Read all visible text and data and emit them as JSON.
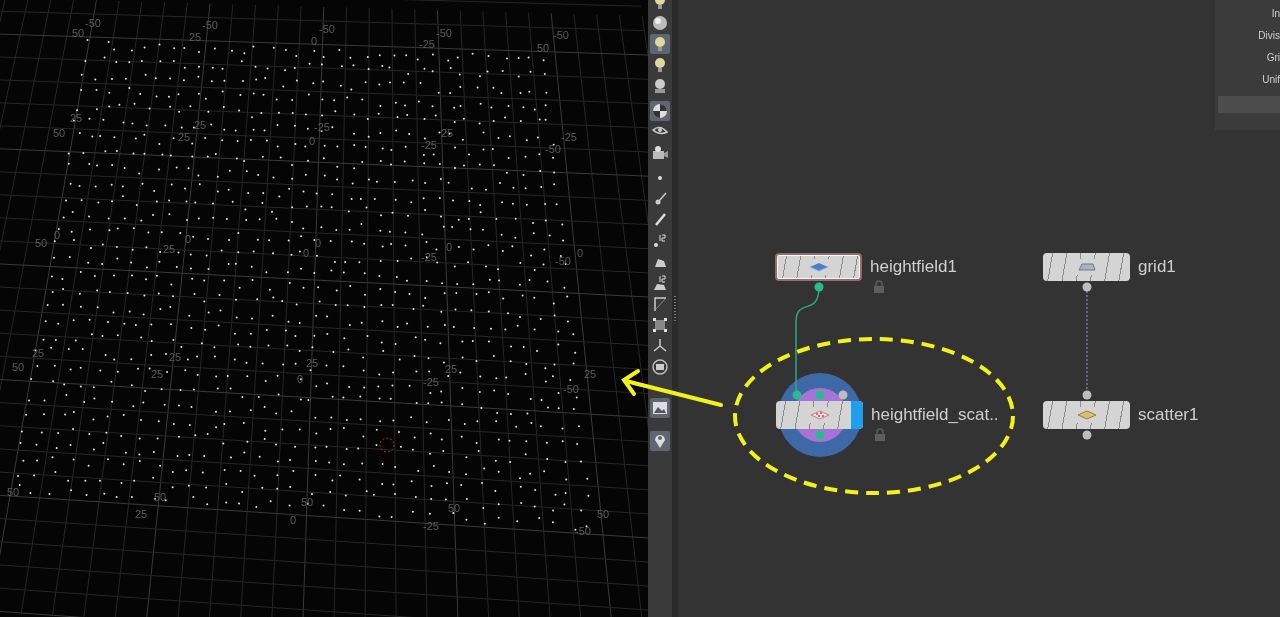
{
  "viewport": {
    "grid_labels": [
      "-50",
      "50",
      "-50",
      "25",
      "-50",
      "0",
      "-50",
      "-25",
      "-50",
      "50",
      "25",
      "50",
      "25",
      "25",
      "-25",
      "0",
      "25",
      "-25",
      "-25",
      "-50",
      "0",
      "50",
      "0",
      "25",
      "0",
      "0",
      "0",
      "-25",
      "0",
      "-50",
      "25",
      "50",
      "25",
      "25",
      "25",
      "0",
      "25",
      "-25",
      "25",
      "-50",
      "50",
      "50",
      "25",
      "50",
      "0",
      "50",
      "-25",
      "50",
      "-50"
    ]
  },
  "toolbar": {
    "tools": [
      {
        "kind": "bulb",
        "selected": false
      },
      {
        "kind": "sphere",
        "selected": false
      },
      {
        "kind": "bulb",
        "selected": true
      },
      {
        "kind": "bulb",
        "selected": false
      },
      {
        "kind": "skull",
        "selected": false
      },
      {
        "kind": "shading",
        "selected": true
      },
      {
        "kind": "eye",
        "selected": false
      },
      {
        "kind": "camera",
        "selected": false
      },
      {
        "kind": "point",
        "selected": false
      },
      {
        "kind": "brush",
        "selected": false
      },
      {
        "kind": "pen",
        "selected": false
      },
      {
        "kind": "point_number",
        "selected": false
      },
      {
        "kind": "sweep",
        "selected": false
      },
      {
        "kind": "sweep_number",
        "selected": false
      },
      {
        "kind": "corner",
        "selected": false
      },
      {
        "kind": "select_box",
        "selected": false
      },
      {
        "kind": "tripod",
        "selected": false
      },
      {
        "kind": "ring",
        "selected": false
      },
      {
        "kind": "picture",
        "selected": true
      },
      {
        "kind": "pin",
        "selected": true
      }
    ]
  },
  "network": {
    "nodes": [
      {
        "kind": "heightfield",
        "name": "heightfield1",
        "outlined": true,
        "locked": true,
        "display_flag": false,
        "ring": false
      },
      {
        "kind": "heightfield_scatter",
        "name": "heightfield_scat..",
        "outlined": false,
        "locked": true,
        "display_flag": true,
        "ring": true
      },
      {
        "kind": "grid",
        "name": "grid1",
        "outlined": false,
        "locked": false,
        "display_flag": false,
        "ring": false
      },
      {
        "kind": "scatter",
        "name": "scatter1",
        "outlined": false,
        "locked": false,
        "display_flag": false,
        "ring": false
      }
    ]
  },
  "parameters": {
    "labels": [
      "In",
      "Divis",
      "Gri",
      "Unif"
    ]
  }
}
